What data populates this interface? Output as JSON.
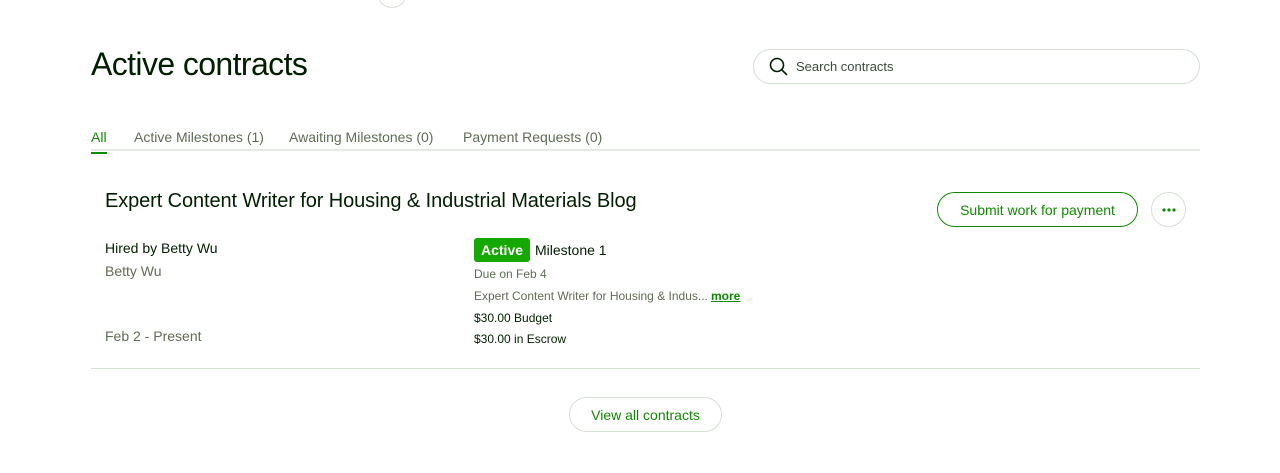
{
  "header": {
    "title": "Active contracts"
  },
  "search": {
    "placeholder": "Search contracts",
    "value": ""
  },
  "tabs": [
    {
      "label": "All",
      "active": true
    },
    {
      "label": "Active Milestones (1)",
      "active": false
    },
    {
      "label": "Awaiting Milestones (0)",
      "active": false
    },
    {
      "label": "Payment Requests (0)",
      "active": false
    }
  ],
  "contract": {
    "title": "Expert Content Writer for Housing & Industrial Materials Blog",
    "hired_by": "Hired by Betty Wu",
    "client_name": "Betty Wu",
    "date_range": "Feb 2 - Present",
    "submit_label": "Submit work for payment",
    "milestone": {
      "status": "Active",
      "name": "Milestone 1",
      "due": "Due on Feb 4",
      "description": "Expert Content Writer for Housing & Indus...",
      "more_label": "more",
      "budget": "$30.00 Budget",
      "escrow": "$30.00 in Escrow"
    }
  },
  "footer": {
    "view_all_label": "View all contracts"
  },
  "colors": {
    "brand_green": "#108a00",
    "badge_green": "#14a800",
    "text_dark": "#001e00",
    "text_muted": "#5e6d55",
    "border": "#d5e0d5"
  },
  "icons": {
    "search": "search-icon",
    "more": "ellipsis-icon"
  }
}
